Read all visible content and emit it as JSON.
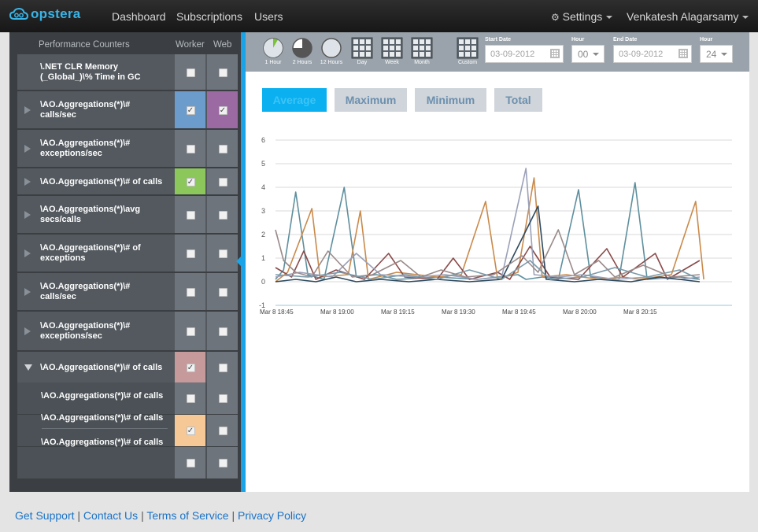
{
  "app": {
    "logo_text": "opstera"
  },
  "nav": {
    "dashboard": "Dashboard",
    "subscriptions": "Subscriptions",
    "users": "Users",
    "settings": "Settings",
    "user_name": "Venkatesh Alagarsamy"
  },
  "sidebar": {
    "header": {
      "counters": "Performance Counters",
      "worker": "Worker",
      "web": "Web"
    },
    "counters": [
      {
        "label": "\\.NET CLR Memory (_Global_)\\% Time in GC",
        "arrow": "none",
        "worker": false,
        "web": false
      },
      {
        "label": "\\AO.Aggregations(*)\\# calls/sec",
        "arrow": "right",
        "worker": true,
        "web": true,
        "worker_color": "#6c9ccc",
        "web_color": "#9b6aa3"
      },
      {
        "label": "\\AO.Aggregations(*)\\# exceptions/sec",
        "arrow": "right",
        "worker": false,
        "web": false
      },
      {
        "label": "\\AO.Aggregations(*)\\# of calls",
        "arrow": "right",
        "worker": true,
        "web": false,
        "worker_color": "#8bc75a"
      },
      {
        "label": "\\AO.Aggregations(*)\\avg secs/calls",
        "arrow": "right",
        "worker": false,
        "web": false
      },
      {
        "label": "\\AO.Aggregations(*)\\# of exceptions",
        "arrow": "right",
        "worker": false,
        "web": false
      },
      {
        "label": "\\AO.Aggregations(*)\\# calls/sec",
        "arrow": "right",
        "worker": false,
        "web": false
      },
      {
        "label": "\\AO.Aggregations(*)\\# exceptions/sec",
        "arrow": "right",
        "worker": false,
        "web": false
      },
      {
        "label": "\\AO.Aggregations(*)\\# of calls",
        "arrow": "down",
        "worker": true,
        "web": false,
        "worker_color": "#c69a9a"
      }
    ],
    "sub_items": [
      {
        "label": "\\AO.Aggregations(*)\\# of calls",
        "worker": false,
        "web": false
      },
      {
        "label": "\\AO.Aggregations(*)\\# of calls",
        "worker": true,
        "web": false,
        "worker_color": "#f5c896"
      },
      {
        "label": "\\AO.Aggregations(*)\\# of calls",
        "worker": false,
        "web": false
      }
    ]
  },
  "toolbar": {
    "ranges": [
      {
        "label": "1 Hour",
        "icon": "clock-1-hour-icon",
        "fill": 0.083,
        "active": true
      },
      {
        "label": "2 Hours",
        "icon": "clock-2-hours-icon",
        "fill": 0.75,
        "active": false
      },
      {
        "label": "12 Hours",
        "icon": "clock-12-hours-icon",
        "fill": 0,
        "active": false
      },
      {
        "label": "Day",
        "icon": "grid-day-icon",
        "active": false
      },
      {
        "label": "Week",
        "icon": "grid-week-icon",
        "active": false
      },
      {
        "label": "Month",
        "icon": "grid-month-icon",
        "active": false
      },
      {
        "label": "Custom",
        "icon": "grid-custom-icon",
        "active": false
      }
    ],
    "start_date_label": "Start Date",
    "start_date_value": "03-09-2012",
    "start_hour_label": "Hour",
    "start_hour_value": "00",
    "end_date_label": "End Date",
    "end_date_value": "03-09-2012",
    "end_hour_label": "Hour",
    "end_hour_value": "24"
  },
  "tabs": [
    {
      "label": "Average",
      "active": true
    },
    {
      "label": "Maximum",
      "active": false
    },
    {
      "label": "Minimum",
      "active": false
    },
    {
      "label": "Total",
      "active": false
    }
  ],
  "chart_data": {
    "type": "line",
    "title": "",
    "xlabel": "",
    "ylabel": "",
    "ylim": [
      -1,
      6
    ],
    "yticks": [
      -1,
      0,
      1,
      2,
      3,
      4,
      5,
      6
    ],
    "xlim": [
      0,
      113
    ],
    "x_ticks": [
      {
        "label": "Mar 8 18:45",
        "minute": 0
      },
      {
        "label": "Mar 8 19:00",
        "minute": 15
      },
      {
        "label": "Mar 8 19:15",
        "minute": 30
      },
      {
        "label": "Mar 8 19:30",
        "minute": 45
      },
      {
        "label": "Mar 8 19:45",
        "minute": 60
      },
      {
        "label": "Mar 8 20:00",
        "minute": 75
      },
      {
        "label": "Mar 8 20:15",
        "minute": 90
      }
    ],
    "grid": true,
    "series": [
      {
        "color": "#5e8f9e",
        "points": [
          [
            0,
            0.1
          ],
          [
            2,
            0.5
          ],
          [
            5,
            3.8
          ],
          [
            8,
            0.3
          ],
          [
            12,
            0.1
          ],
          [
            17,
            4.0
          ],
          [
            20,
            0.2
          ],
          [
            25,
            0.3
          ],
          [
            30,
            0.1
          ],
          [
            40,
            0.2
          ],
          [
            50,
            0.1
          ],
          [
            60,
            0.3
          ],
          [
            62,
            0.1
          ],
          [
            66,
            0.2
          ],
          [
            70,
            0.1
          ],
          [
            75,
            3.9
          ],
          [
            78,
            0.2
          ],
          [
            85,
            0.1
          ],
          [
            89,
            4.2
          ],
          [
            92,
            0.1
          ],
          [
            100,
            0.2
          ],
          [
            105,
            0.1
          ]
        ]
      },
      {
        "color": "#c98a4b",
        "points": [
          [
            0,
            0.0
          ],
          [
            3,
            0.4
          ],
          [
            9,
            3.1
          ],
          [
            11,
            0.2
          ],
          [
            18,
            0.3
          ],
          [
            21,
            3.0
          ],
          [
            23,
            0.1
          ],
          [
            30,
            0.4
          ],
          [
            40,
            0.2
          ],
          [
            46,
            0.3
          ],
          [
            52,
            3.4
          ],
          [
            55,
            0.1
          ],
          [
            60,
            0.4
          ],
          [
            64,
            4.4
          ],
          [
            66,
            0.2
          ],
          [
            72,
            0.3
          ],
          [
            80,
            0.1
          ],
          [
            86,
            0.2
          ],
          [
            90,
            0.1
          ],
          [
            98,
            0.3
          ],
          [
            104,
            3.4
          ],
          [
            106,
            0.1
          ]
        ]
      },
      {
        "color": "#8a4a4a",
        "points": [
          [
            0,
            0.6
          ],
          [
            4,
            0.2
          ],
          [
            7,
            1.3
          ],
          [
            10,
            0.1
          ],
          [
            15,
            0.5
          ],
          [
            22,
            0.1
          ],
          [
            28,
            1.2
          ],
          [
            32,
            0.2
          ],
          [
            40,
            0.1
          ],
          [
            44,
            1.0
          ],
          [
            48,
            0.1
          ],
          [
            55,
            0.4
          ],
          [
            58,
            0.1
          ],
          [
            63,
            1.5
          ],
          [
            68,
            0.2
          ],
          [
            75,
            0.1
          ],
          [
            82,
            1.4
          ],
          [
            86,
            0.2
          ],
          [
            94,
            1.2
          ],
          [
            97,
            0.1
          ],
          [
            105,
            0.9
          ]
        ]
      },
      {
        "color": "#9aa0b8",
        "points": [
          [
            0,
            0.2
          ],
          [
            6,
            0.4
          ],
          [
            14,
            0.2
          ],
          [
            20,
            1.2
          ],
          [
            26,
            0.3
          ],
          [
            35,
            0.2
          ],
          [
            42,
            0.3
          ],
          [
            50,
            0.1
          ],
          [
            56,
            0.2
          ],
          [
            62,
            4.8
          ],
          [
            64,
            0.3
          ],
          [
            70,
            0.2
          ],
          [
            76,
            0.3
          ],
          [
            84,
            0.1
          ],
          [
            92,
            0.2
          ],
          [
            100,
            0.1
          ],
          [
            105,
            0.2
          ]
        ]
      },
      {
        "color": "#2f4a5e",
        "points": [
          [
            0,
            0.0
          ],
          [
            5,
            0.1
          ],
          [
            10,
            0.0
          ],
          [
            15,
            0.2
          ],
          [
            20,
            0.0
          ],
          [
            26,
            0.1
          ],
          [
            33,
            0.0
          ],
          [
            40,
            0.1
          ],
          [
            48,
            0.0
          ],
          [
            56,
            0.1
          ],
          [
            65,
            3.2
          ],
          [
            67,
            0.1
          ],
          [
            74,
            0.0
          ],
          [
            80,
            0.1
          ],
          [
            88,
            0.0
          ],
          [
            95,
            0.2
          ],
          [
            105,
            0.0
          ]
        ]
      },
      {
        "color": "#9a8a8a",
        "points": [
          [
            0,
            2.2
          ],
          [
            2,
            0.9
          ],
          [
            5,
            0.4
          ],
          [
            9,
            0.2
          ],
          [
            13,
            1.3
          ],
          [
            19,
            0.2
          ],
          [
            24,
            0.3
          ],
          [
            31,
            0.9
          ],
          [
            36,
            0.2
          ],
          [
            41,
            0.5
          ],
          [
            47,
            0.2
          ],
          [
            54,
            0.3
          ],
          [
            61,
            1.1
          ],
          [
            65,
            0.4
          ],
          [
            70,
            2.2
          ],
          [
            74,
            0.3
          ],
          [
            80,
            0.9
          ],
          [
            84,
            0.2
          ],
          [
            91,
            0.7
          ],
          [
            98,
            0.2
          ],
          [
            105,
            0.3
          ]
        ]
      },
      {
        "color": "#7a9aaa",
        "points": [
          [
            0,
            0.3
          ],
          [
            8,
            0.2
          ],
          [
            16,
            0.4
          ],
          [
            24,
            0.1
          ],
          [
            32,
            0.3
          ],
          [
            40,
            0.1
          ],
          [
            48,
            0.5
          ],
          [
            56,
            0.1
          ],
          [
            63,
            0.9
          ],
          [
            68,
            0.1
          ],
          [
            76,
            0.2
          ],
          [
            84,
            0.6
          ],
          [
            92,
            0.2
          ],
          [
            100,
            0.5
          ],
          [
            105,
            0.1
          ]
        ]
      }
    ]
  },
  "footer": {
    "get_support": "Get Support",
    "contact_us": "Contact Us",
    "terms": "Terms of Service",
    "privacy": "Privacy Policy",
    "separator": "|"
  }
}
